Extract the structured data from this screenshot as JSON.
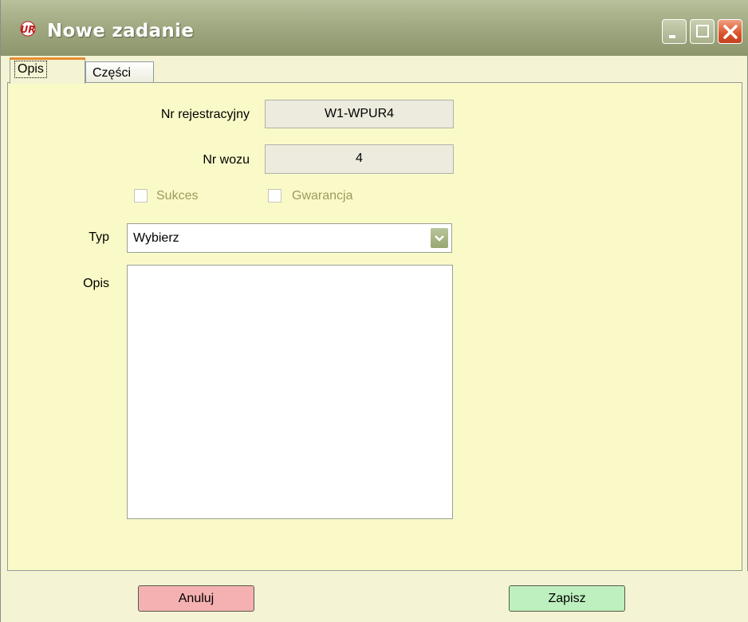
{
  "window": {
    "title": "Nowe zadanie",
    "app_icon": "ur-logo-icon"
  },
  "title_buttons": {
    "minimize_icon": "minimize-icon",
    "maximize_icon": "maximize-icon",
    "close_icon": "close-icon"
  },
  "tabs": [
    {
      "label": "Opis",
      "active": true
    },
    {
      "label": "Części",
      "active": false
    }
  ],
  "form": {
    "registration_label": "Nr rejestracyjny",
    "registration_value": "W1-WPUR4",
    "car_number_label": "Nr wozu",
    "car_number_value": "4",
    "success_label": "Sukces",
    "warranty_label": "Gwarancja",
    "type_label": "Typ",
    "type_value": "Wybierz",
    "description_label": "Opis",
    "description_value": ""
  },
  "buttons": {
    "cancel_label": "Anuluj",
    "save_label": "Zapisz"
  },
  "colors": {
    "panel_background": "#fafac8",
    "window_background": "#f4f4d4",
    "titlebar": "#a1aa82",
    "cancel_button": "#f5b1b2",
    "save_button": "#bdf0be",
    "active_tab_accent": "#e68b2c",
    "disabled_label": "#9a9b5e"
  }
}
